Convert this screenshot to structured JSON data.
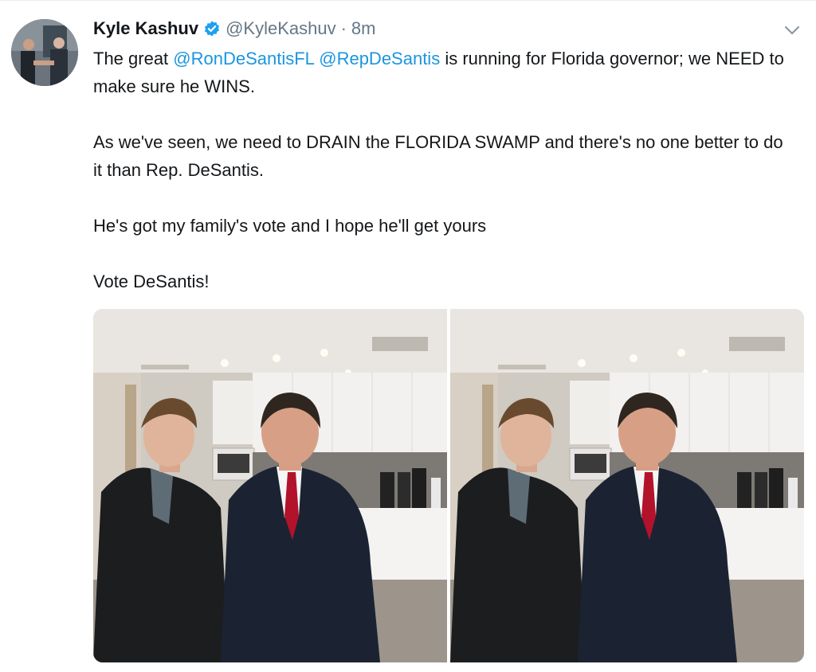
{
  "tweet": {
    "display_name": "Kyle Kashuv",
    "handle": "@KyleKashuv",
    "separator": "·",
    "time": "8m",
    "verified": true,
    "text": {
      "p1_pre": "The great ",
      "mention1": "@RonDeSantisFL",
      "space": " ",
      "mention2": "@RepDeSantis",
      "p1_post": " is running for Florida governor; we NEED to make sure he WINS.",
      "p2": "As we've seen, we need to DRAIN the FLORIDA SWAMP and there's no one better to do it than Rep. DeSantis.",
      "p3": "He's got my family's vote and I hope he'll get yours",
      "p4": "Vote DeSantis!"
    },
    "media_count": 2
  },
  "colors": {
    "text": "#14171a",
    "secondary": "#657786",
    "link": "#1b95e0",
    "verified": "#1da1f2"
  },
  "icons": {
    "verified": "verified-badge-icon",
    "caret": "chevron-down-icon"
  }
}
